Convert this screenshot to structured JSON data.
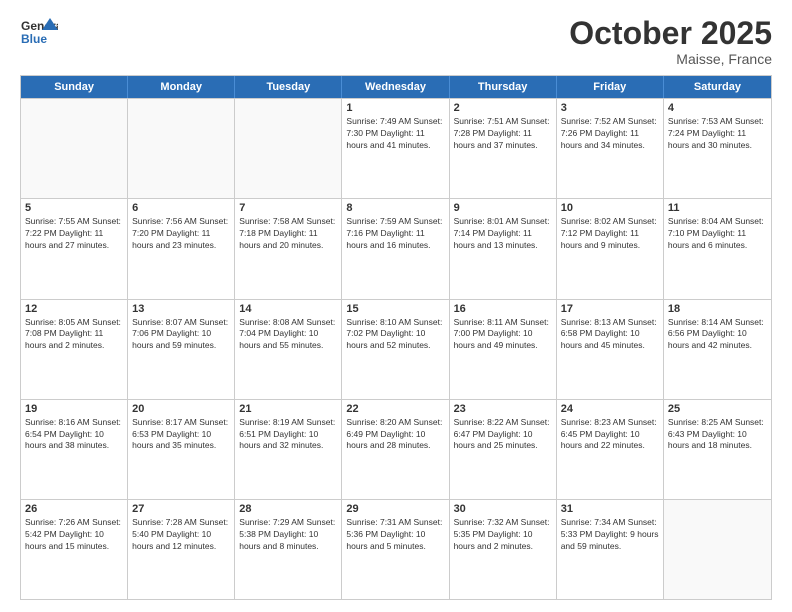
{
  "logo": {
    "general": "General",
    "blue": "Blue"
  },
  "header": {
    "month": "October 2025",
    "location": "Maisse, France"
  },
  "weekdays": [
    "Sunday",
    "Monday",
    "Tuesday",
    "Wednesday",
    "Thursday",
    "Friday",
    "Saturday"
  ],
  "rows": [
    [
      {
        "day": "",
        "info": ""
      },
      {
        "day": "",
        "info": ""
      },
      {
        "day": "",
        "info": ""
      },
      {
        "day": "1",
        "info": "Sunrise: 7:49 AM\nSunset: 7:30 PM\nDaylight: 11 hours\nand 41 minutes."
      },
      {
        "day": "2",
        "info": "Sunrise: 7:51 AM\nSunset: 7:28 PM\nDaylight: 11 hours\nand 37 minutes."
      },
      {
        "day": "3",
        "info": "Sunrise: 7:52 AM\nSunset: 7:26 PM\nDaylight: 11 hours\nand 34 minutes."
      },
      {
        "day": "4",
        "info": "Sunrise: 7:53 AM\nSunset: 7:24 PM\nDaylight: 11 hours\nand 30 minutes."
      }
    ],
    [
      {
        "day": "5",
        "info": "Sunrise: 7:55 AM\nSunset: 7:22 PM\nDaylight: 11 hours\nand 27 minutes."
      },
      {
        "day": "6",
        "info": "Sunrise: 7:56 AM\nSunset: 7:20 PM\nDaylight: 11 hours\nand 23 minutes."
      },
      {
        "day": "7",
        "info": "Sunrise: 7:58 AM\nSunset: 7:18 PM\nDaylight: 11 hours\nand 20 minutes."
      },
      {
        "day": "8",
        "info": "Sunrise: 7:59 AM\nSunset: 7:16 PM\nDaylight: 11 hours\nand 16 minutes."
      },
      {
        "day": "9",
        "info": "Sunrise: 8:01 AM\nSunset: 7:14 PM\nDaylight: 11 hours\nand 13 minutes."
      },
      {
        "day": "10",
        "info": "Sunrise: 8:02 AM\nSunset: 7:12 PM\nDaylight: 11 hours\nand 9 minutes."
      },
      {
        "day": "11",
        "info": "Sunrise: 8:04 AM\nSunset: 7:10 PM\nDaylight: 11 hours\nand 6 minutes."
      }
    ],
    [
      {
        "day": "12",
        "info": "Sunrise: 8:05 AM\nSunset: 7:08 PM\nDaylight: 11 hours\nand 2 minutes."
      },
      {
        "day": "13",
        "info": "Sunrise: 8:07 AM\nSunset: 7:06 PM\nDaylight: 10 hours\nand 59 minutes."
      },
      {
        "day": "14",
        "info": "Sunrise: 8:08 AM\nSunset: 7:04 PM\nDaylight: 10 hours\nand 55 minutes."
      },
      {
        "day": "15",
        "info": "Sunrise: 8:10 AM\nSunset: 7:02 PM\nDaylight: 10 hours\nand 52 minutes."
      },
      {
        "day": "16",
        "info": "Sunrise: 8:11 AM\nSunset: 7:00 PM\nDaylight: 10 hours\nand 49 minutes."
      },
      {
        "day": "17",
        "info": "Sunrise: 8:13 AM\nSunset: 6:58 PM\nDaylight: 10 hours\nand 45 minutes."
      },
      {
        "day": "18",
        "info": "Sunrise: 8:14 AM\nSunset: 6:56 PM\nDaylight: 10 hours\nand 42 minutes."
      }
    ],
    [
      {
        "day": "19",
        "info": "Sunrise: 8:16 AM\nSunset: 6:54 PM\nDaylight: 10 hours\nand 38 minutes."
      },
      {
        "day": "20",
        "info": "Sunrise: 8:17 AM\nSunset: 6:53 PM\nDaylight: 10 hours\nand 35 minutes."
      },
      {
        "day": "21",
        "info": "Sunrise: 8:19 AM\nSunset: 6:51 PM\nDaylight: 10 hours\nand 32 minutes."
      },
      {
        "day": "22",
        "info": "Sunrise: 8:20 AM\nSunset: 6:49 PM\nDaylight: 10 hours\nand 28 minutes."
      },
      {
        "day": "23",
        "info": "Sunrise: 8:22 AM\nSunset: 6:47 PM\nDaylight: 10 hours\nand 25 minutes."
      },
      {
        "day": "24",
        "info": "Sunrise: 8:23 AM\nSunset: 6:45 PM\nDaylight: 10 hours\nand 22 minutes."
      },
      {
        "day": "25",
        "info": "Sunrise: 8:25 AM\nSunset: 6:43 PM\nDaylight: 10 hours\nand 18 minutes."
      }
    ],
    [
      {
        "day": "26",
        "info": "Sunrise: 7:26 AM\nSunset: 5:42 PM\nDaylight: 10 hours\nand 15 minutes."
      },
      {
        "day": "27",
        "info": "Sunrise: 7:28 AM\nSunset: 5:40 PM\nDaylight: 10 hours\nand 12 minutes."
      },
      {
        "day": "28",
        "info": "Sunrise: 7:29 AM\nSunset: 5:38 PM\nDaylight: 10 hours\nand 8 minutes."
      },
      {
        "day": "29",
        "info": "Sunrise: 7:31 AM\nSunset: 5:36 PM\nDaylight: 10 hours\nand 5 minutes."
      },
      {
        "day": "30",
        "info": "Sunrise: 7:32 AM\nSunset: 5:35 PM\nDaylight: 10 hours\nand 2 minutes."
      },
      {
        "day": "31",
        "info": "Sunrise: 7:34 AM\nSunset: 5:33 PM\nDaylight: 9 hours\nand 59 minutes."
      },
      {
        "day": "",
        "info": ""
      }
    ]
  ]
}
